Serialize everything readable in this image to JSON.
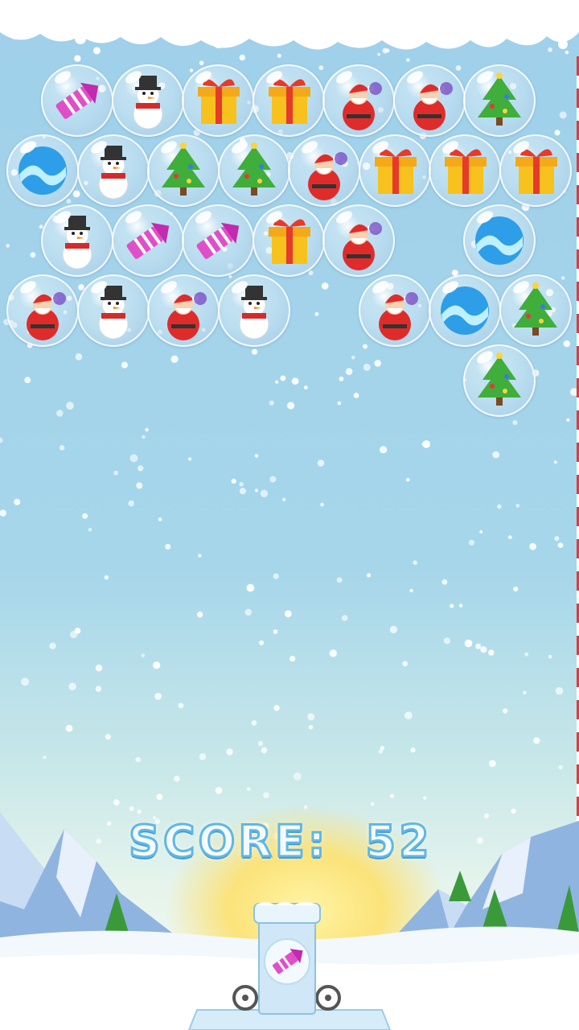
{
  "game": {
    "score_label": "SCORE:",
    "score_value": "52"
  },
  "board": {
    "rows": [
      [
        "rocket",
        "snowman",
        "gift",
        "gift",
        "santa",
        "santa",
        "tree"
      ],
      [
        "ball",
        "snowman",
        "tree",
        "tree",
        "santa",
        "gift",
        "gift",
        "gift"
      ],
      [
        "snowman",
        "rocket",
        "rocket",
        "gift",
        "santa",
        null,
        "ball"
      ],
      [
        "santa",
        "snowman",
        "santa",
        "snowman",
        null,
        "santa",
        "ball",
        "tree"
      ],
      [
        null,
        null,
        null,
        null,
        null,
        null,
        "tree"
      ]
    ]
  },
  "shooter": {
    "loaded_bubble": "rocket"
  },
  "icons": {
    "rocket": "firework-rocket-icon",
    "snowman": "snowman-icon",
    "gift": "gift-box-icon",
    "santa": "santa-claus-icon",
    "tree": "christmas-tree-icon",
    "ball": "blue-wave-ball-icon"
  },
  "colors": {
    "sky": "#a6d6ea",
    "score_text": "#f4fbff",
    "score_outline": "#5fb7e6",
    "rocket": "#e04fc8",
    "gift": "#f7c21d",
    "santa": "#e02b2b",
    "tree": "#3fae3a",
    "ball": "#2e9ee8"
  }
}
